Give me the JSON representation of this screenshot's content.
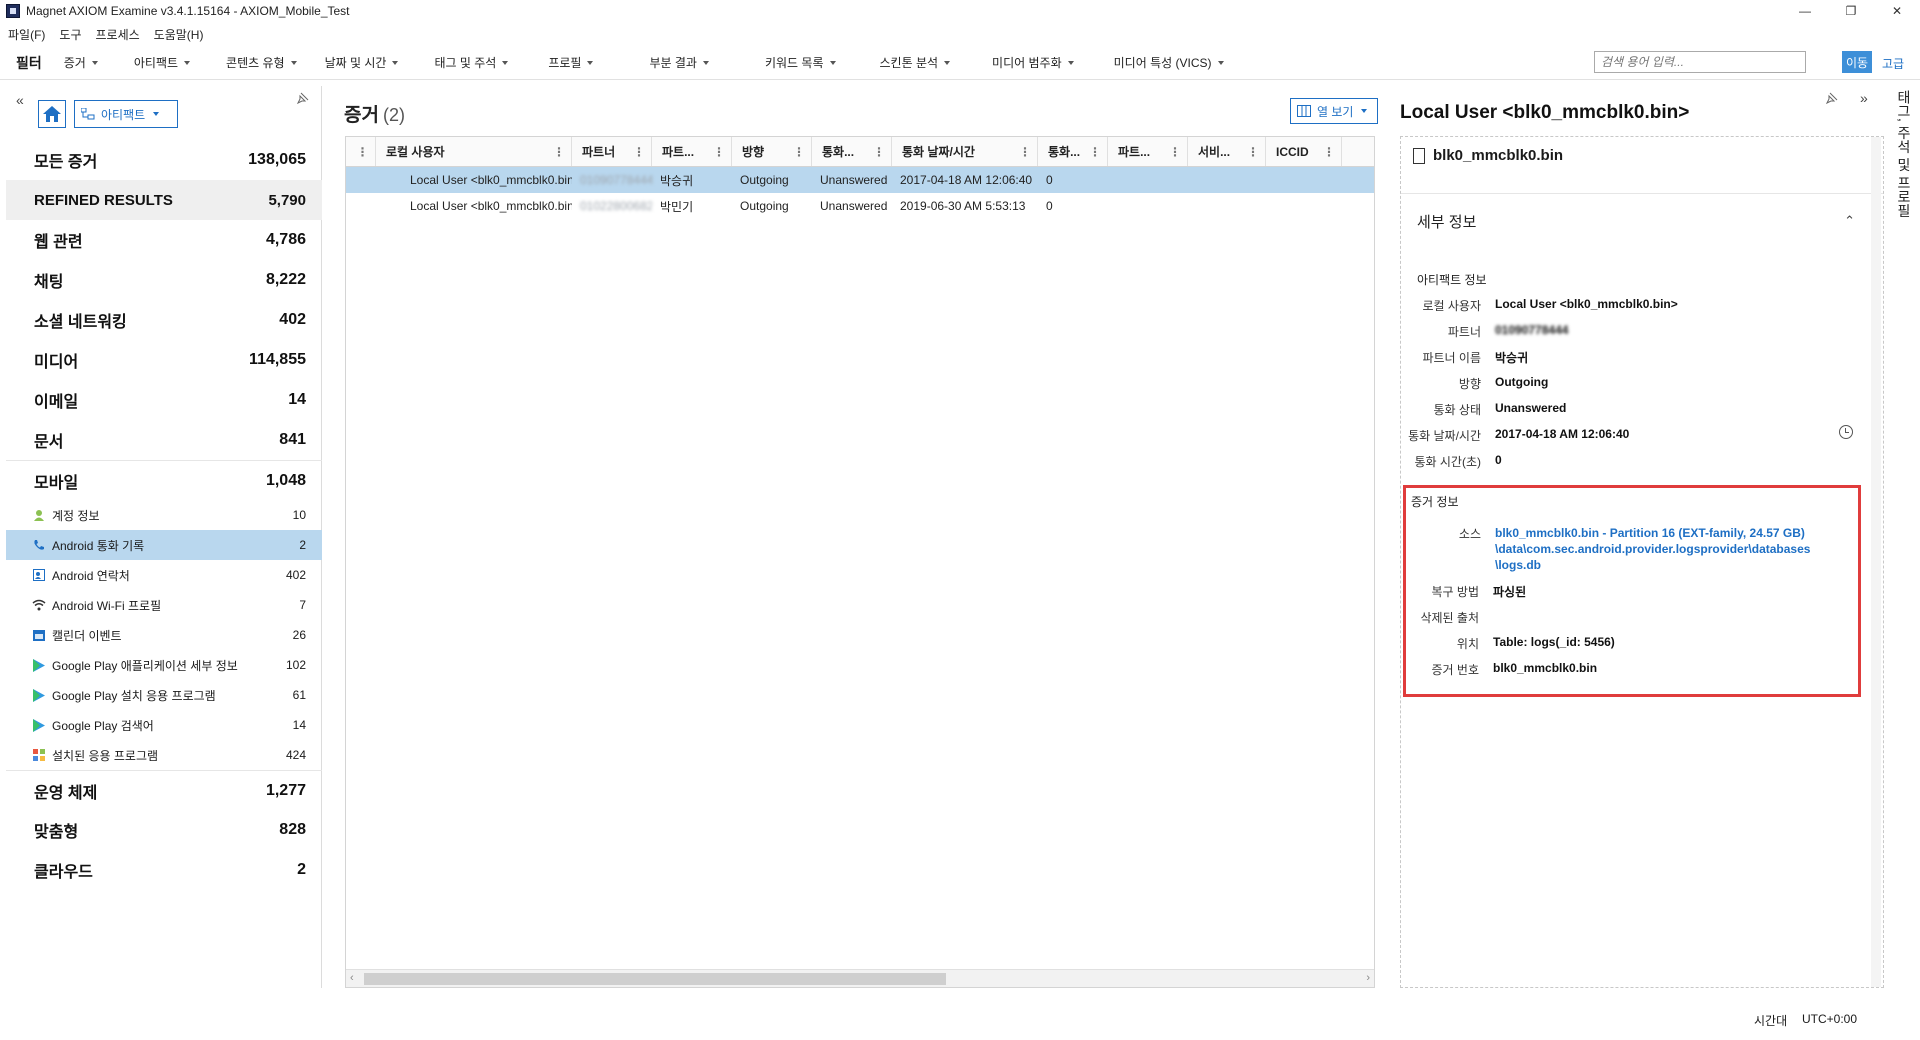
{
  "window": {
    "title": "Magnet AXIOM Examine v3.4.1.15164 - AXIOM_Mobile_Test",
    "minimize": "—",
    "restore": "❐",
    "close": "✕"
  },
  "menu": [
    "파일(F)",
    "도구",
    "프로세스",
    "도움말(H)"
  ],
  "filterbar": {
    "label": "필터",
    "items": [
      "증거",
      "아티팩트",
      "콘텐츠 유형",
      "날짜 및 시간",
      "태그 및 주석",
      "프로필",
      "부분 결과",
      "키워드 목록",
      "스킨톤 분석",
      "미디어 범주화",
      "미디어 특성 (VICS)"
    ],
    "search_placeholder": "검색 용어 입력...",
    "go_label": "이동",
    "advanced_label": "고급"
  },
  "left": {
    "collapse": "«",
    "view_label": "아티팩트",
    "categories_top": [
      {
        "label": "모든 증거",
        "count": "138,065"
      },
      {
        "label": "REFINED RESULTS",
        "count": "5,790"
      },
      {
        "label": "웹 관련",
        "count": "4,786"
      },
      {
        "label": "채팅",
        "count": "8,222"
      },
      {
        "label": "소셜 네트워킹",
        "count": "402"
      },
      {
        "label": "미디어",
        "count": "114,855"
      },
      {
        "label": "이메일",
        "count": "14"
      },
      {
        "label": "문서",
        "count": "841"
      }
    ],
    "mobile": {
      "label": "모바일",
      "count": "1,048"
    },
    "mobile_items": [
      {
        "label": "계정 정보",
        "count": "10",
        "icon": "user-icon"
      },
      {
        "label": "Android 통화 기록",
        "count": "2",
        "icon": "phone-icon"
      },
      {
        "label": "Android 연락처",
        "count": "402",
        "icon": "contacts-icon"
      },
      {
        "label": "Android Wi-Fi 프로필",
        "count": "7",
        "icon": "wifi-icon"
      },
      {
        "label": "캘린더 이벤트",
        "count": "26",
        "icon": "calendar-icon"
      },
      {
        "label": "Google Play 애플리케이션 세부 정보",
        "count": "102",
        "icon": "play-icon"
      },
      {
        "label": "Google Play 설치 응용 프로그램",
        "count": "61",
        "icon": "play-icon"
      },
      {
        "label": "Google Play 검색어",
        "count": "14",
        "icon": "play-icon"
      },
      {
        "label": "설치된 응용 프로그램",
        "count": "424",
        "icon": "apps-icon"
      }
    ],
    "categories_bottom": [
      {
        "label": "운영 체제",
        "count": "1,277"
      },
      {
        "label": "맞춤형",
        "count": "828"
      },
      {
        "label": "클라우드",
        "count": "2"
      }
    ]
  },
  "center": {
    "title": "증거",
    "count": "(2)",
    "column_view_label": "열 보기",
    "columns": [
      "로컬 사용자",
      "파트너",
      "파트...",
      "방향",
      "통화...",
      "통화 날짜/시간",
      "통화...",
      "파트...",
      "서비...",
      "ICCID"
    ],
    "rows": [
      [
        "Local User <blk0_mmcblk0.bin>",
        "01090778444",
        "박승귀",
        "Outgoing",
        "Unanswered",
        "2017-04-18 AM 12:06:40",
        "0",
        "",
        "",
        ""
      ],
      [
        "Local User <blk0_mmcblk0.bin>",
        "01022800682",
        "박민기",
        "Outgoing",
        "Unanswered",
        "2019-06-30 AM 5:53:13",
        "0",
        "",
        "",
        ""
      ]
    ]
  },
  "right": {
    "title": "Local User <blk0_mmcblk0.bin>",
    "file_name": "blk0_mmcblk0.bin",
    "details_title": "세부 정보",
    "artifact_section": "아티팩트 정보",
    "artifact_fields": [
      {
        "key": "로컬 사용자",
        "value": "Local User <blk0_mmcblk0.bin>"
      },
      {
        "key": "파트너",
        "value": "01090778444"
      },
      {
        "key": "파트너 이름",
        "value": "박승귀"
      },
      {
        "key": "방향",
        "value": "Outgoing"
      },
      {
        "key": "통화 상태",
        "value": "Unanswered"
      },
      {
        "key": "통화 날짜/시간",
        "value": "2017-04-18 AM 12:06:40"
      },
      {
        "key": "통화 시간(초)",
        "value": "0"
      }
    ],
    "evidence_section": "증거 정보",
    "source_key": "소스",
    "source_lines": [
      "blk0_mmcblk0.bin - Partition 16 (EXT-family, 24.57 GB)",
      "\\data\\com.sec.android.provider.logsprovider\\databases",
      "\\logs.db"
    ],
    "recovery_key": "복구 방법",
    "recovery_value": "파싱된",
    "deleted_key": "삭제된 출처",
    "location_key": "위치",
    "location_value": "Table: logs(_id: 5456)",
    "evidence_no_key": "증거 번호",
    "evidence_no_value": "blk0_mmcblk0.bin",
    "vertical_tab": "태그, 주석 및 프로필"
  },
  "status": {
    "tz_label": "시간대",
    "tz_value": "UTC+0:00"
  }
}
